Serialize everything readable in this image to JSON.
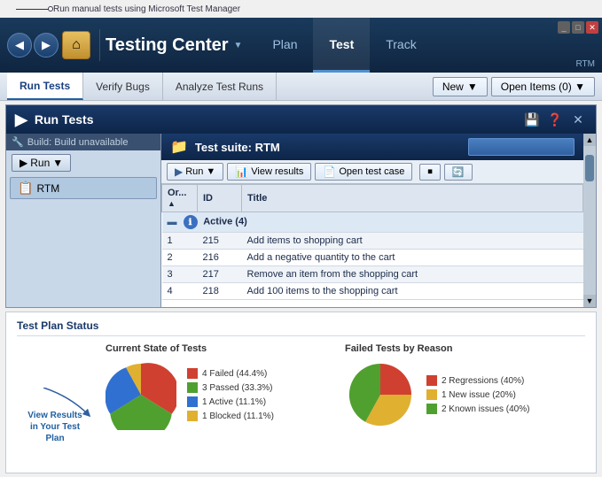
{
  "annotation": {
    "text": "Run manual tests using Microsoft Test Manager"
  },
  "topbar": {
    "title": "Testing Center",
    "tabs": [
      {
        "label": "Plan",
        "active": false
      },
      {
        "label": "Test",
        "active": true
      },
      {
        "label": "Track",
        "active": false
      }
    ],
    "rtm_label": "RTM"
  },
  "toolbar2": {
    "tabs": [
      {
        "label": "Run Tests",
        "active": true
      },
      {
        "label": "Verify Bugs",
        "active": false
      },
      {
        "label": "Analyze Test Runs",
        "active": false
      }
    ],
    "new_btn": "New",
    "open_items_btn": "Open Items (0)"
  },
  "run_tests_panel": {
    "title": "Run Tests",
    "build_label": "Build: Build unavailable",
    "run_btn": "Run",
    "tree_item": "RTM",
    "suite": {
      "label": "Test suite:  RTM"
    },
    "run_toolbar": {
      "run": "Run",
      "view_results": "View results",
      "open_test_case": "Open test case"
    },
    "table": {
      "headers": [
        "Or...",
        "ID",
        "Title"
      ],
      "active_group": "Active (4)",
      "rows": [
        {
          "order": "1",
          "id": "215",
          "title": "Add items to shopping cart"
        },
        {
          "order": "2",
          "id": "216",
          "title": "Add a negative quantity to the cart"
        },
        {
          "order": "3",
          "id": "217",
          "title": "Remove an item from the shopping cart"
        },
        {
          "order": "4",
          "id": "218",
          "title": "Add 100 items to the shopping cart"
        }
      ]
    }
  },
  "status_panel": {
    "title": "Test Plan Status",
    "current_state": {
      "title": "Current State of Tests",
      "legend": [
        {
          "color": "#d04030",
          "label": "4 Failed (44.4%)"
        },
        {
          "color": "#50a030",
          "label": "3 Passed (33.3%)"
        },
        {
          "color": "#3070d0",
          "label": "1 Active (11.1%)"
        },
        {
          "color": "#e0b030",
          "label": "1 Blocked (11.1%)"
        }
      ]
    },
    "failed_by_reason": {
      "title": "Failed Tests by Reason",
      "legend": [
        {
          "color": "#d04030",
          "label": "2 Regressions (40%)"
        },
        {
          "color": "#e0b030",
          "label": "1 New issue (20%)"
        },
        {
          "color": "#50a030",
          "label": "2 Known issues (40%)"
        }
      ]
    },
    "callout_text": "View Results in Your Test Plan"
  }
}
